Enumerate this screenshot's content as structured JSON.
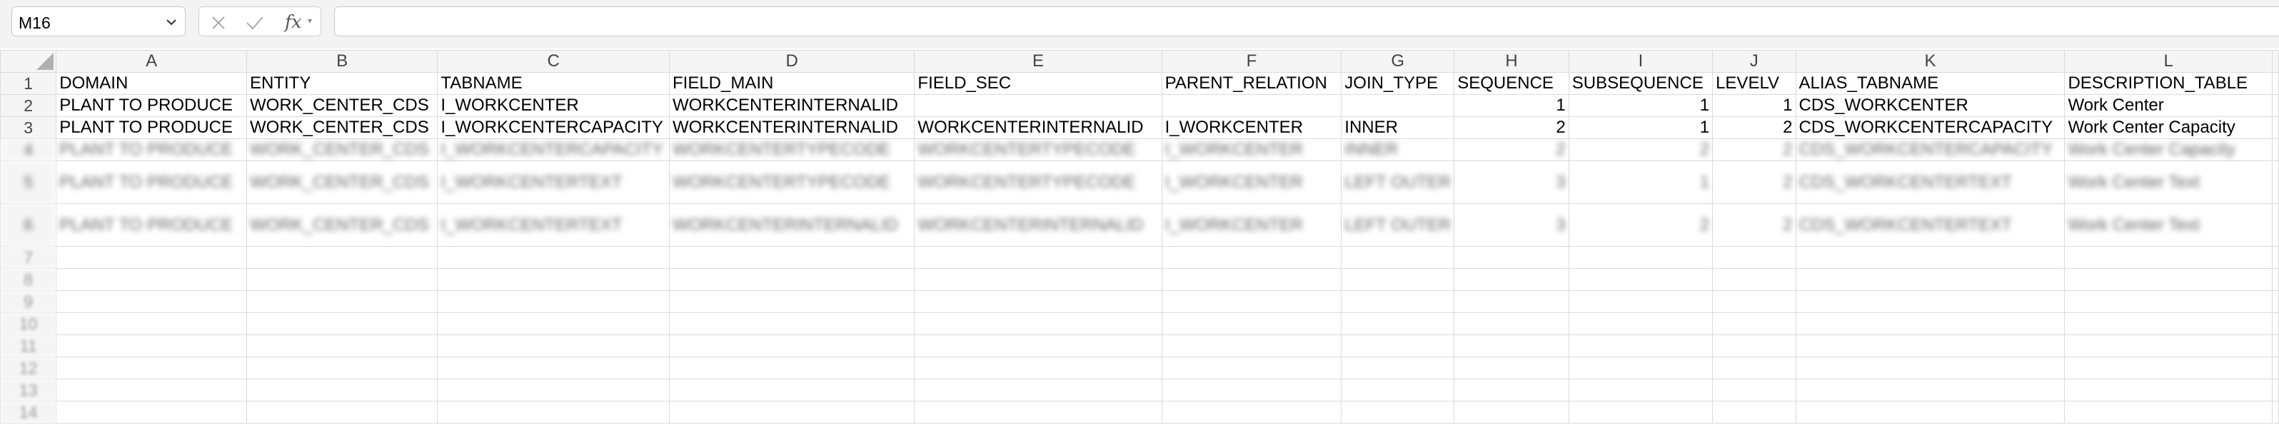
{
  "name_box": {
    "value": "M16"
  },
  "formula_bar": {
    "fx_label": "fx",
    "value": ""
  },
  "columns": [
    "A",
    "B",
    "C",
    "D",
    "E",
    "F",
    "G",
    "H",
    "I",
    "J",
    "K",
    "L"
  ],
  "rows": [
    {
      "num": "1",
      "cells": [
        "DOMAIN",
        "ENTITY",
        "TABNAME",
        "FIELD_MAIN",
        "FIELD_SEC",
        "PARENT_RELATION",
        "JOIN_TYPE",
        "SEQUENCE",
        "SUBSEQUENCE",
        "LEVELV",
        "ALIAS_TABNAME",
        "DESCRIPTION_TABLE"
      ]
    },
    {
      "num": "2",
      "cells": [
        "PLANT TO PRODUCE",
        "WORK_CENTER_CDS",
        "I_WORKCENTER",
        "WORKCENTERINTERNALID",
        "",
        "",
        "",
        "1",
        "1",
        "1",
        "CDS_WORKCENTER",
        "Work Center"
      ]
    },
    {
      "num": "3",
      "cells": [
        "PLANT TO PRODUCE",
        "WORK_CENTER_CDS",
        "I_WORKCENTERCAPACITY",
        "WORKCENTERINTERNALID",
        "WORKCENTERINTERNALID",
        "I_WORKCENTER",
        "INNER",
        "2",
        "1",
        "2",
        "CDS_WORKCENTERCAPACITY",
        "Work Center Capacity"
      ]
    },
    {
      "num": "4",
      "cells": [
        "PLANT TO PRODUCE",
        "WORK_CENTER_CDS",
        "I_WORKCENTERCAPACITY",
        "WORKCENTERTYPECODE",
        "WORKCENTERTYPECODE",
        "I_WORKCENTER",
        "INNER",
        "2",
        "2",
        "2",
        "CDS_WORKCENTERCAPACITY",
        "Work Center Capacity"
      ]
    },
    {
      "num": "5",
      "cells": [
        "PLANT TO PRODUCE",
        "WORK_CENTER_CDS",
        "I_WORKCENTERTEXT",
        "WORKCENTERTYPECODE",
        "WORKCENTERTYPECODE",
        "I_WORKCENTER",
        "LEFT OUTER",
        "3",
        "1",
        "2",
        "CDS_WORKCENTERTEXT",
        "Work Center Text"
      ]
    },
    {
      "num": "6",
      "cells": [
        "PLANT TO PRODUCE",
        "WORK_CENTER_CDS",
        "I_WORKCENTERTEXT",
        "WORKCENTERINTERNALID",
        "WORKCENTERINTERNALID",
        "I_WORKCENTER",
        "LEFT OUTER",
        "3",
        "2",
        "2",
        "CDS_WORKCENTERTEXT",
        "Work Center Text"
      ]
    },
    {
      "num": "7",
      "cells": [
        "",
        "",
        "",
        "",
        "",
        "",
        "",
        "",
        "",
        "",
        "",
        ""
      ]
    },
    {
      "num": "8",
      "cells": [
        "",
        "",
        "",
        "",
        "",
        "",
        "",
        "",
        "",
        "",
        "",
        ""
      ]
    },
    {
      "num": "9",
      "cells": [
        "",
        "",
        "",
        "",
        "",
        "",
        "",
        "",
        "",
        "",
        "",
        ""
      ]
    },
    {
      "num": "10",
      "cells": [
        "",
        "",
        "",
        "",
        "",
        "",
        "",
        "",
        "",
        "",
        "",
        ""
      ]
    },
    {
      "num": "11",
      "cells": [
        "",
        "",
        "",
        "",
        "",
        "",
        "",
        "",
        "",
        "",
        "",
        ""
      ]
    },
    {
      "num": "12",
      "cells": [
        "",
        "",
        "",
        "",
        "",
        "",
        "",
        "",
        "",
        "",
        "",
        ""
      ]
    },
    {
      "num": "13",
      "cells": [
        "",
        "",
        "",
        "",
        "",
        "",
        "",
        "",
        "",
        "",
        "",
        ""
      ]
    },
    {
      "num": "14",
      "cells": [
        "",
        "",
        "",
        "",
        "",
        "",
        "",
        "",
        "",
        "",
        "",
        ""
      ]
    }
  ]
}
